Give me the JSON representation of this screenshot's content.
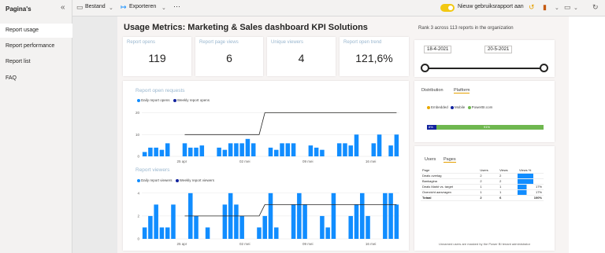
{
  "pane": {
    "title": "Pagina's",
    "items": [
      {
        "label": "Report usage",
        "active": true
      },
      {
        "label": "Report performance",
        "active": false
      },
      {
        "label": "Report list",
        "active": false
      },
      {
        "label": "FAQ",
        "active": false
      }
    ]
  },
  "toolbar": {
    "file": "Bestand",
    "export": "Exporteren",
    "more": "···",
    "new_report_toggle": "Nieuw gebruiksrapport aan"
  },
  "report": {
    "title": "Usage Metrics: Marketing & Sales dashboard KPI Solutions",
    "rank": "Rank 3 across 113 reports in the organization"
  },
  "kpis": [
    {
      "label": "Report opens",
      "value": "119"
    },
    {
      "label": "Report page views",
      "value": "6"
    },
    {
      "label": "Unique viewers",
      "value": "4"
    },
    {
      "label": "Report open trend",
      "value": "121,6%"
    }
  ],
  "date_slicer": {
    "start": "18-4-2021",
    "end": "20-5-2021"
  },
  "distribution": {
    "tabs": [
      "Distribution",
      "Platform"
    ],
    "selected_tab": "Platform",
    "legend": [
      "Embedded",
      "Mobile",
      "PowerBI.com"
    ],
    "bar_labels": [
      "8%",
      "91%"
    ]
  },
  "pages_panel": {
    "tabs": [
      "Users",
      "Pages"
    ],
    "selected_tab": "Pages",
    "columns": [
      "Page",
      "Users",
      "Views",
      "Views %"
    ],
    "rows": [
      {
        "page": "Deals overlag",
        "users": "2",
        "views": "2",
        "pct": ""
      },
      {
        "page": "Bankagina",
        "users": "2",
        "views": "2",
        "pct": ""
      },
      {
        "page": "Deals Markt vs. target",
        "users": "1",
        "views": "1",
        "pct": "17%"
      },
      {
        "page": "Overzicht aanvragen",
        "users": "1",
        "views": "1",
        "pct": "17%"
      }
    ],
    "total": {
      "page": "Totaal",
      "users": "2",
      "views": "6",
      "pct": "100%"
    },
    "footnote": "Unnamed users are masked by the Power BI tenant administrator"
  },
  "colors": {
    "accent": "#f2c811",
    "daily": "#118dff",
    "weekly": "#12239e",
    "green": "#6fb74f"
  },
  "chart_data": [
    {
      "type": "bar",
      "title": "Report open requests",
      "series": [
        {
          "name": "Daily report opens",
          "values": [
            2,
            4,
            4,
            3,
            6,
            0,
            0,
            6,
            4,
            4,
            5,
            0,
            0,
            4,
            3,
            6,
            6,
            6,
            8,
            6,
            0,
            0,
            4,
            3,
            6,
            6,
            6,
            0,
            0,
            5,
            4,
            3,
            0,
            0,
            6,
            6,
            5,
            10,
            0,
            0,
            6,
            10,
            0,
            5,
            10
          ]
        },
        {
          "name": "Weekly report opens",
          "values": [
            null,
            null,
            null,
            null,
            null,
            null,
            null,
            10,
            10,
            10,
            10,
            10,
            10,
            10,
            10,
            10,
            10,
            10,
            10,
            10,
            10,
            20,
            20,
            20,
            20,
            20,
            20,
            20,
            20,
            20,
            20,
            20,
            20,
            20,
            20,
            20,
            20,
            20,
            20,
            20,
            20,
            20,
            20,
            20,
            20
          ]
        }
      ],
      "x_ticks": [
        "25 apr",
        "02 mei",
        "09 mei",
        "16 mei"
      ],
      "y_ticks": [
        0,
        10,
        20
      ],
      "ylim": [
        0,
        22
      ]
    },
    {
      "type": "bar",
      "title": "Report viewers",
      "series": [
        {
          "name": "Daily report viewers",
          "values": [
            1,
            2,
            3,
            1,
            1,
            3,
            0,
            0,
            4,
            2,
            0,
            1,
            0,
            0,
            3,
            4,
            3,
            2,
            0,
            0,
            1,
            2,
            4,
            1,
            0,
            0,
            3,
            4,
            3,
            0,
            0,
            2,
            1,
            4,
            0,
            0,
            2,
            3,
            4,
            2,
            0,
            0,
            4,
            4,
            3
          ]
        },
        {
          "name": "Weekly report viewers",
          "values": [
            null,
            null,
            null,
            null,
            null,
            null,
            null,
            2,
            2,
            2,
            2,
            2,
            2,
            2,
            2,
            2,
            2,
            2,
            2,
            2,
            2,
            3,
            3,
            3,
            3,
            3,
            3,
            3,
            3,
            3,
            3,
            3,
            3,
            3,
            3,
            3,
            3,
            3,
            3,
            3,
            3,
            3,
            3,
            3,
            3
          ]
        }
      ],
      "x_ticks": [
        "25 apr",
        "02 mei",
        "09 mei",
        "16 mei"
      ],
      "y_ticks": [
        0,
        2,
        4
      ],
      "ylim": [
        0,
        4.4
      ]
    }
  ]
}
